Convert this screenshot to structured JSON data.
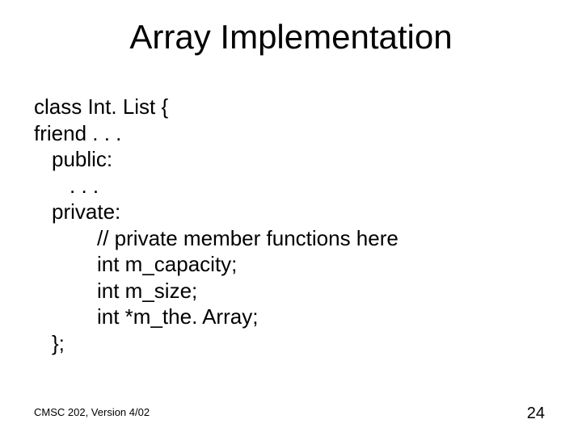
{
  "title": "Array Implementation",
  "code": {
    "l0": "class Int. List {",
    "l1": "friend . . .",
    "l2": "public:",
    "l3": ". . .",
    "l4": "private:",
    "l5": "// private member functions here",
    "l6": "int m_capacity;",
    "l7": "int m_size;",
    "l8": "int *m_the. Array;",
    "l9": "};"
  },
  "footer_left": "CMSC 202, Version 4/02",
  "footer_right": "24"
}
